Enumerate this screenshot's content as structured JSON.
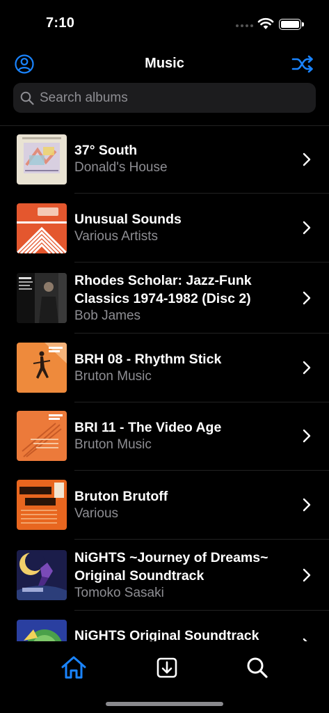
{
  "status_bar": {
    "time": "7:10"
  },
  "header": {
    "title": "Music"
  },
  "search": {
    "placeholder": "Search albums"
  },
  "albums": [
    {
      "title": "37° South",
      "artist": "Donald's House"
    },
    {
      "title": "Unusual Sounds",
      "artist": "Various Artists"
    },
    {
      "title": "Rhodes Scholar: Jazz-Funk Classics 1974-1982 (Disc 2)",
      "artist": "Bob James"
    },
    {
      "title": "BRH 08 - Rhythm Stick",
      "artist": "Bruton Music"
    },
    {
      "title": "BRI 11 - The Video Age",
      "artist": "Bruton Music"
    },
    {
      "title": "Bruton Brutoff",
      "artist": "Various"
    },
    {
      "title": "NiGHTS ~Journey of Dreams~ Original Soundtrack",
      "artist": "Tomoko Sasaki"
    },
    {
      "title": "NiGHTS Original Soundtrack",
      "artist": ""
    }
  ],
  "tabs": [
    {
      "name": "home",
      "icon": "house-icon",
      "selected": true
    },
    {
      "name": "downloads",
      "icon": "download-icon",
      "selected": false
    },
    {
      "name": "search",
      "icon": "search-icon",
      "selected": false
    }
  ],
  "colors": {
    "accent": "#1a84ff",
    "background": "#000000",
    "secondary_text": "#8e8e93",
    "search_bg": "#1c1c1e"
  }
}
